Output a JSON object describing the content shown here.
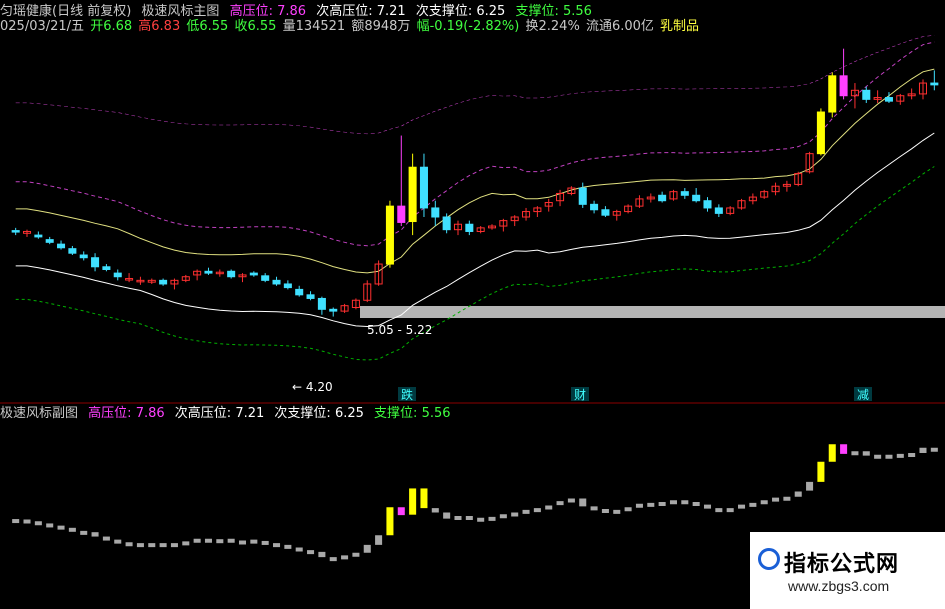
{
  "header": {
    "stock": "匀瑶健康(日线 前复权)",
    "indicator": "极速风标主图",
    "high_resist_label": "高压位:",
    "high_resist_value": "7.86",
    "next_resist_label": "次高压位:",
    "next_resist_value": "7.21",
    "next_support_label": "次支撑位:",
    "next_support_value": "6.25",
    "support_label": "支撑位:",
    "support_value": "5.56"
  },
  "quote": {
    "date": "025/03/21/五",
    "open": "开6.68",
    "high": "高6.83",
    "low": "低6.55",
    "close": "收6.55",
    "volume": "量134521",
    "amount": "额8948万",
    "change": "幅-0.19(-2.82%)",
    "turnover": "换2.24%",
    "float": "流通6.00亿",
    "sector": "乳制品"
  },
  "sub": {
    "indicator": "极速风标副图",
    "high_resist_label": "高压位:",
    "high_resist_value": "7.86",
    "next_resist_label": "次高压位:",
    "next_resist_value": "7.21",
    "next_support_label": "次支撑位:",
    "next_support_value": "6.25",
    "support_label": "支撑位:",
    "support_value": "5.56"
  },
  "colors": {
    "up": "#ff3030",
    "down": "#40e0ff",
    "yellow": "#ffff00",
    "magenta": "#ff40ff",
    "band_gray": "#b4b4b4",
    "upper_dashed": "#ff40ff",
    "lower_dashed": "#00c000"
  },
  "chart_data": {
    "type": "candlestick",
    "title": "极速风标主图",
    "ylim": [
      4.0,
      8.0
    ],
    "band_label": "5.05 - 5.22",
    "low_label": "4.20",
    "event_markers": [
      "跌",
      "财",
      "减"
    ],
    "ohlc": [
      [
        5.85,
        5.88,
        5.8,
        5.84
      ],
      [
        5.82,
        5.86,
        5.78,
        5.84
      ],
      [
        5.8,
        5.84,
        5.76,
        5.78
      ],
      [
        5.75,
        5.78,
        5.7,
        5.72
      ],
      [
        5.7,
        5.74,
        5.64,
        5.66
      ],
      [
        5.65,
        5.68,
        5.58,
        5.6
      ],
      [
        5.58,
        5.62,
        5.52,
        5.55
      ],
      [
        5.55,
        5.6,
        5.4,
        5.45
      ],
      [
        5.45,
        5.48,
        5.4,
        5.42
      ],
      [
        5.38,
        5.42,
        5.3,
        5.34
      ],
      [
        5.32,
        5.38,
        5.28,
        5.32
      ],
      [
        5.3,
        5.34,
        5.25,
        5.3
      ],
      [
        5.28,
        5.32,
        5.26,
        5.3
      ],
      [
        5.3,
        5.32,
        5.24,
        5.26
      ],
      [
        5.26,
        5.32,
        5.2,
        5.3
      ],
      [
        5.3,
        5.36,
        5.28,
        5.34
      ],
      [
        5.36,
        5.42,
        5.3,
        5.4
      ],
      [
        5.4,
        5.44,
        5.36,
        5.38
      ],
      [
        5.38,
        5.42,
        5.34,
        5.39
      ],
      [
        5.4,
        5.42,
        5.32,
        5.34
      ],
      [
        5.34,
        5.38,
        5.28,
        5.36
      ],
      [
        5.38,
        5.4,
        5.34,
        5.36
      ],
      [
        5.35,
        5.38,
        5.28,
        5.3
      ],
      [
        5.3,
        5.34,
        5.24,
        5.26
      ],
      [
        5.26,
        5.3,
        5.2,
        5.22
      ],
      [
        5.2,
        5.24,
        5.12,
        5.14
      ],
      [
        5.14,
        5.18,
        5.08,
        5.1
      ],
      [
        5.1,
        5.12,
        4.92,
        4.98
      ],
      [
        4.98,
        5.0,
        4.9,
        4.96
      ],
      [
        4.96,
        5.04,
        4.94,
        5.02
      ],
      [
        5.0,
        5.1,
        4.98,
        5.08
      ],
      [
        5.08,
        5.3,
        5.06,
        5.26
      ],
      [
        5.26,
        5.52,
        5.24,
        5.48
      ],
      [
        5.48,
        6.18,
        5.44,
        6.12
      ],
      [
        6.12,
        6.9,
        5.9,
        5.94
      ],
      [
        5.95,
        6.7,
        5.8,
        6.55
      ],
      [
        6.55,
        6.7,
        6.0,
        6.1
      ],
      [
        6.1,
        6.18,
        5.9,
        6.0
      ],
      [
        6.0,
        6.04,
        5.82,
        5.86
      ],
      [
        5.86,
        5.96,
        5.8,
        5.92
      ],
      [
        5.92,
        5.96,
        5.8,
        5.84
      ],
      [
        5.84,
        5.9,
        5.82,
        5.88
      ],
      [
        5.88,
        5.92,
        5.86,
        5.9
      ],
      [
        5.9,
        5.98,
        5.84,
        5.96
      ],
      [
        5.96,
        6.02,
        5.9,
        6.0
      ],
      [
        6.0,
        6.1,
        5.96,
        6.06
      ],
      [
        6.06,
        6.12,
        6.0,
        6.1
      ],
      [
        6.12,
        6.2,
        6.06,
        6.16
      ],
      [
        6.18,
        6.3,
        6.12,
        6.26
      ],
      [
        6.26,
        6.34,
        6.24,
        6.32
      ],
      [
        6.32,
        6.38,
        6.1,
        6.14
      ],
      [
        6.14,
        6.18,
        6.04,
        6.08
      ],
      [
        6.08,
        6.12,
        6.0,
        6.02
      ],
      [
        6.02,
        6.08,
        5.96,
        6.06
      ],
      [
        6.06,
        6.14,
        6.04,
        6.12
      ],
      [
        6.12,
        6.24,
        6.1,
        6.2
      ],
      [
        6.2,
        6.26,
        6.16,
        6.22
      ],
      [
        6.24,
        6.28,
        6.16,
        6.18
      ],
      [
        6.2,
        6.3,
        6.18,
        6.28
      ],
      [
        6.28,
        6.32,
        6.2,
        6.24
      ],
      [
        6.24,
        6.32,
        6.16,
        6.18
      ],
      [
        6.18,
        6.22,
        6.06,
        6.1
      ],
      [
        6.1,
        6.14,
        6.0,
        6.04
      ],
      [
        6.04,
        6.12,
        6.02,
        6.1
      ],
      [
        6.1,
        6.2,
        6.08,
        6.18
      ],
      [
        6.18,
        6.26,
        6.14,
        6.22
      ],
      [
        6.22,
        6.3,
        6.2,
        6.28
      ],
      [
        6.28,
        6.38,
        6.24,
        6.34
      ],
      [
        6.34,
        6.4,
        6.28,
        6.36
      ],
      [
        6.36,
        6.5,
        6.34,
        6.48
      ],
      [
        6.5,
        6.72,
        6.48,
        6.7
      ],
      [
        6.7,
        7.2,
        6.68,
        7.16
      ],
      [
        7.16,
        7.6,
        7.1,
        7.56
      ],
      [
        7.56,
        7.86,
        7.3,
        7.34
      ],
      [
        7.34,
        7.48,
        7.2,
        7.4
      ],
      [
        7.4,
        7.44,
        7.26,
        7.3
      ],
      [
        7.3,
        7.4,
        7.26,
        7.32
      ],
      [
        7.32,
        7.38,
        7.26,
        7.28
      ],
      [
        7.28,
        7.36,
        7.24,
        7.34
      ],
      [
        7.34,
        7.42,
        7.3,
        7.36
      ],
      [
        7.36,
        7.52,
        7.3,
        7.48
      ],
      [
        7.48,
        7.62,
        7.4,
        7.46
      ]
    ]
  }
}
